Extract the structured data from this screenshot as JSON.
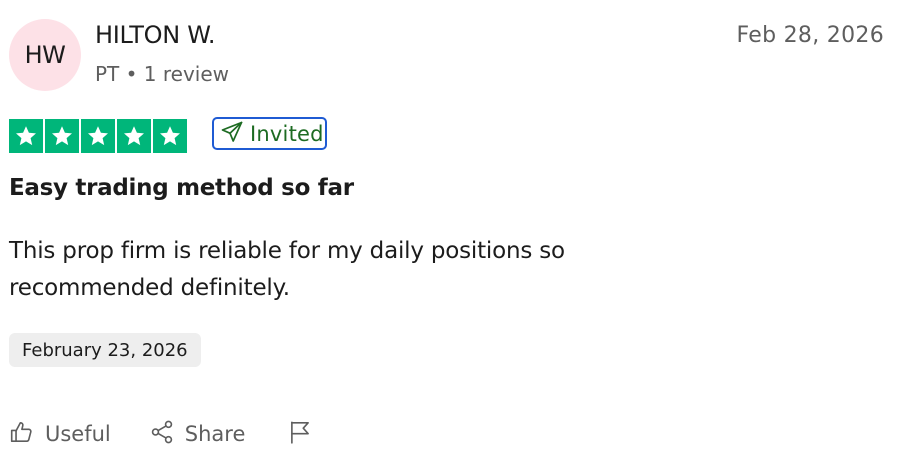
{
  "reviewer": {
    "initials": "HW",
    "name": "HILTON W.",
    "meta": "PT • 1 review"
  },
  "review": {
    "date": "Feb 28, 2026",
    "rating": 5,
    "badge_label": "Invited",
    "title": "Easy trading method so far",
    "body": "This prop firm is reliable for my daily positions so recommended definitely.",
    "experience_date": "February 23, 2026"
  },
  "actions": {
    "useful_label": "Useful",
    "share_label": "Share"
  },
  "colors": {
    "star_green": "#00b67a",
    "badge_border": "#1f5bd3",
    "badge_text": "#1d6b22",
    "avatar_bg": "#fde1e7",
    "muted_text": "#5e5e5e",
    "date_chip_bg": "#eeeeee"
  },
  "icons": {
    "star": "star-icon",
    "invited": "paper-plane-icon",
    "useful": "thumbs-up-icon",
    "share": "share-icon",
    "report": "flag-icon"
  }
}
